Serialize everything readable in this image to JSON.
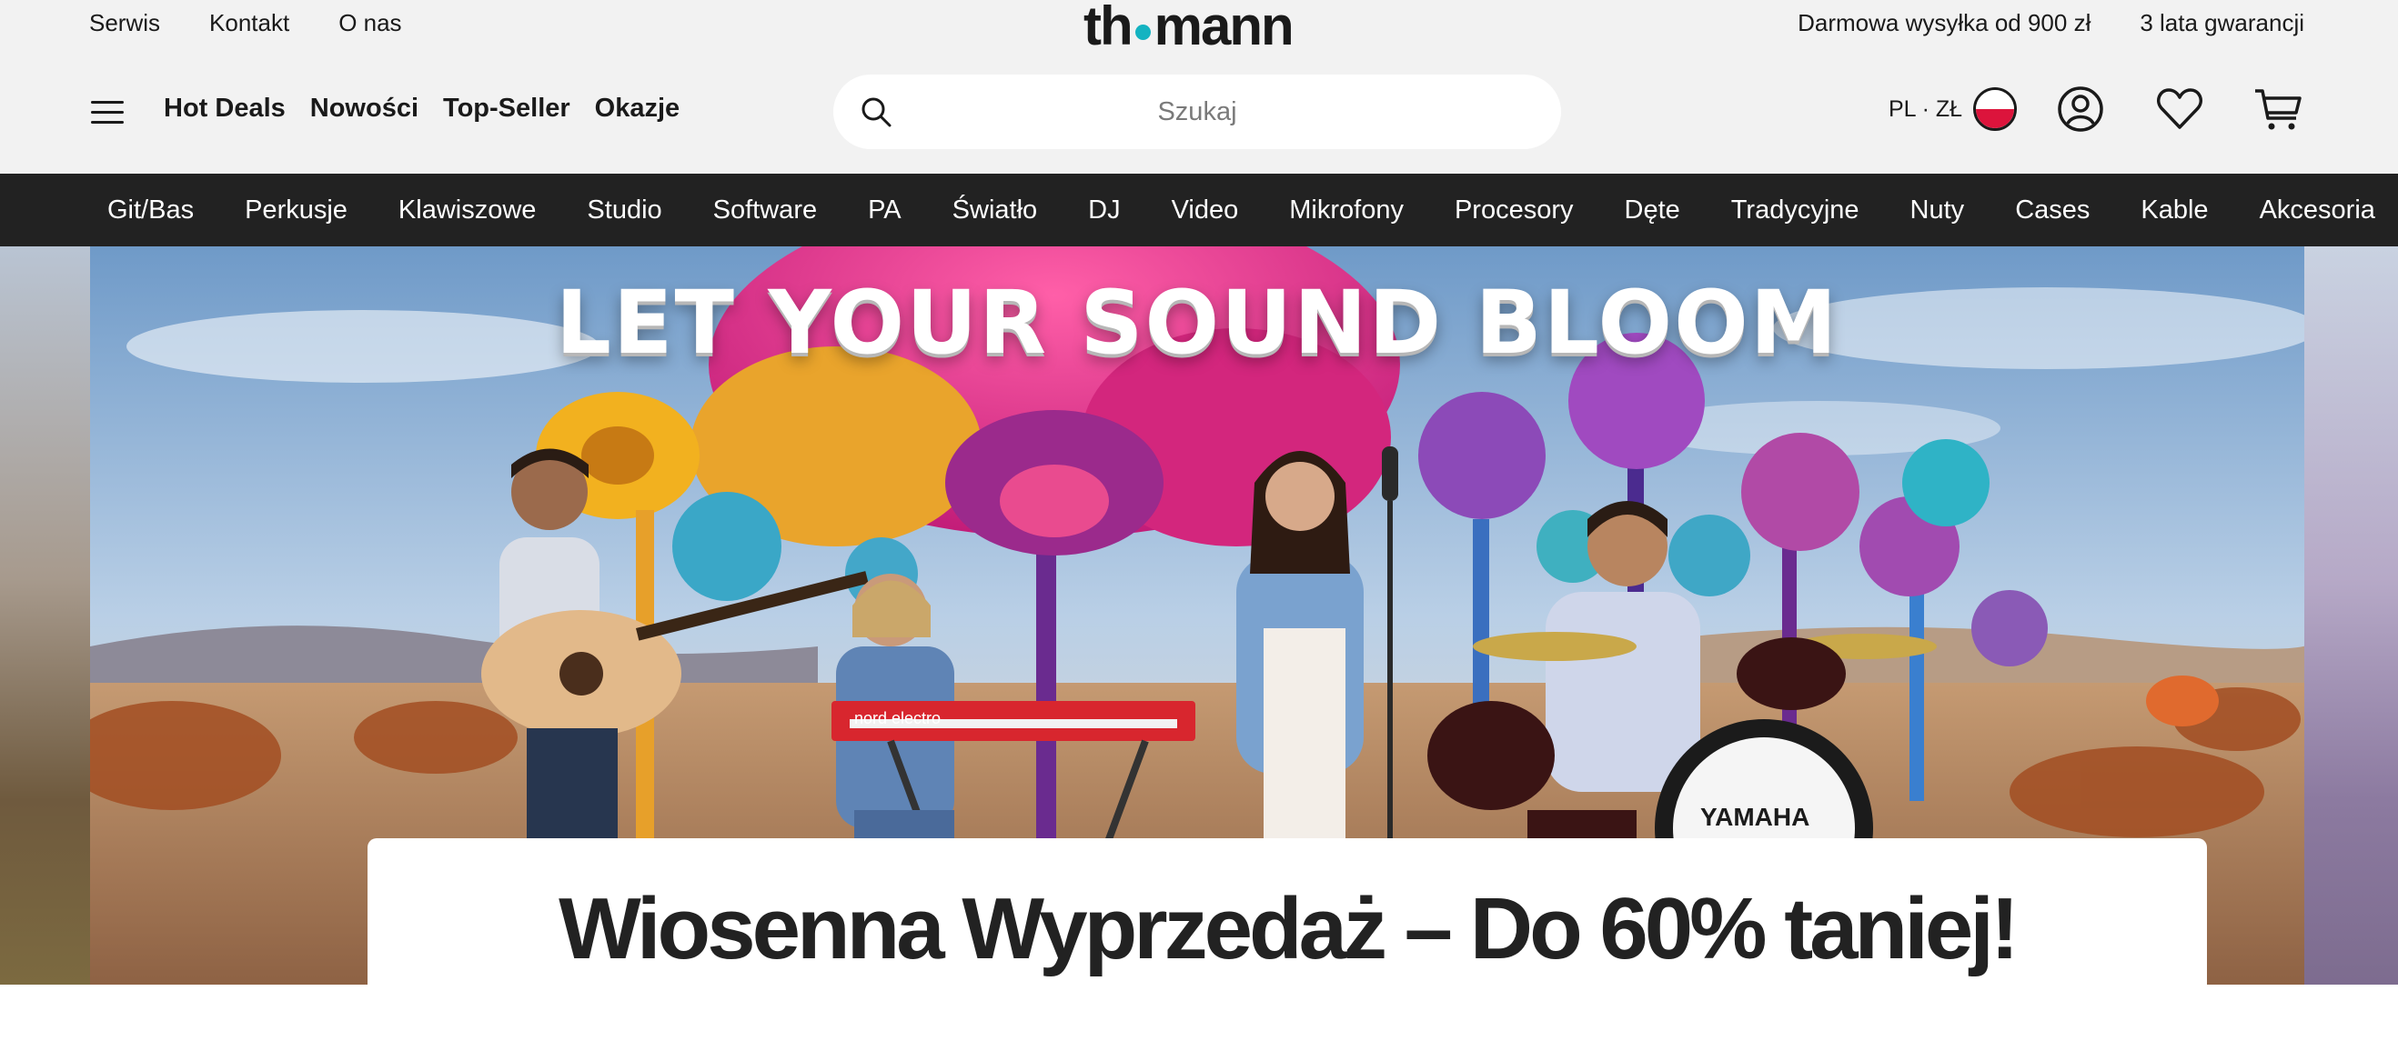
{
  "topbar": {
    "left_links": [
      "Serwis",
      "Kontakt",
      "O nas"
    ],
    "right_links": [
      "Darmowa wysyłka od 900 zł",
      "3 lata gwarancji"
    ]
  },
  "logo": {
    "part1": "th",
    "part2": "mann"
  },
  "header": {
    "quicknav": [
      "Hot Deals",
      "Nowości",
      "Top-Seller",
      "Okazje"
    ],
    "search": {
      "placeholder": "Szukaj",
      "value": ""
    },
    "locale": "PL · ZŁ"
  },
  "categories": [
    "Git/Bas",
    "Perkusje",
    "Klawiszowe",
    "Studio",
    "Software",
    "PA",
    "Światło",
    "DJ",
    "Video",
    "Mikrofony",
    "Procesory",
    "Dęte",
    "Tradycyjne",
    "Nuty",
    "Cases",
    "Kable",
    "Akcesoria"
  ],
  "hero": {
    "headline": "LET YOUR SOUND BLOOM",
    "keyboard_brand": "nord electro",
    "drum_brand": "YAMAHA"
  },
  "promo": {
    "title": "Wiosenna Wyprzedaż – Do 60% taniej!"
  },
  "colors": {
    "logo_dot": "#14b3c1",
    "catnav_bg": "#222222",
    "page_bg": "#f2f2f2"
  }
}
